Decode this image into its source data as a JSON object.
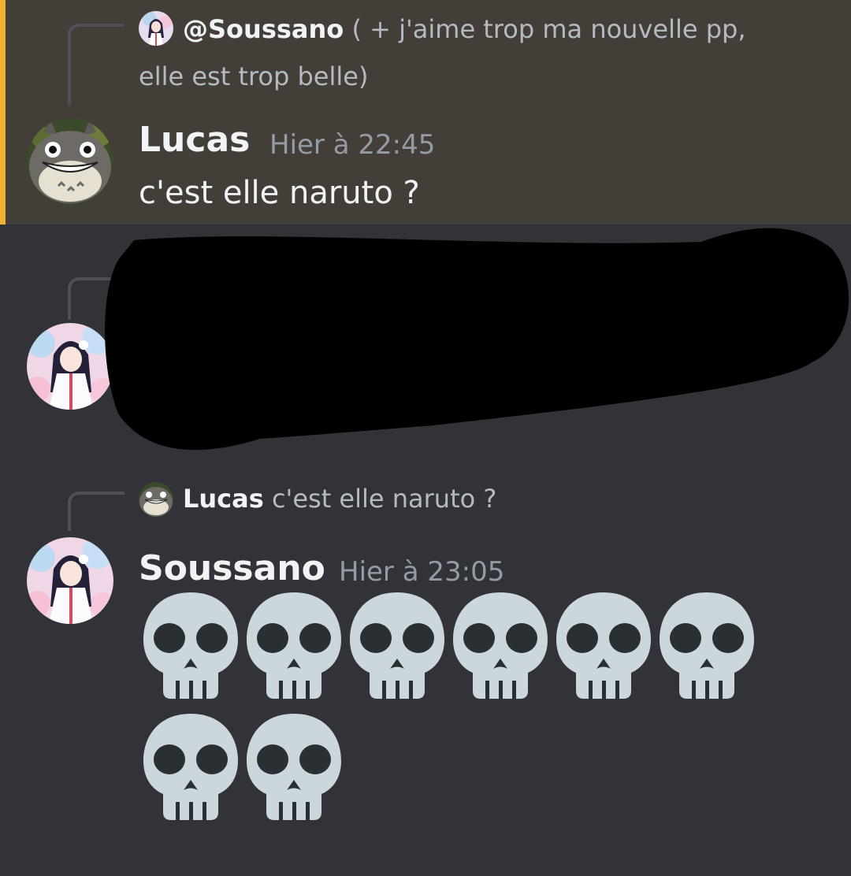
{
  "messages": [
    {
      "reply": {
        "mention": "@Soussano",
        "text_line1": " ( + j'aime trop ma nouvelle pp,",
        "text_line2": "elle est trop belle)"
      },
      "author": "Lucas",
      "timestamp": "Hier à 22:45",
      "content": "c'est elle naruto ?",
      "highlighted": true,
      "highlight_color": "#433f38",
      "accent_color": "#f0b232"
    },
    {
      "redacted": true
    },
    {
      "reply": {
        "name": "Lucas",
        "text": "c'est elle naruto ?"
      },
      "author": "Soussano",
      "timestamp": "Hier à 23:05",
      "emoji": [
        "skull",
        "skull",
        "skull",
        "skull",
        "skull",
        "skull",
        "skull",
        "skull"
      ]
    }
  ],
  "colors": {
    "background": "#313338",
    "username": "#f2f3f5",
    "timestamp": "#949ba4"
  }
}
